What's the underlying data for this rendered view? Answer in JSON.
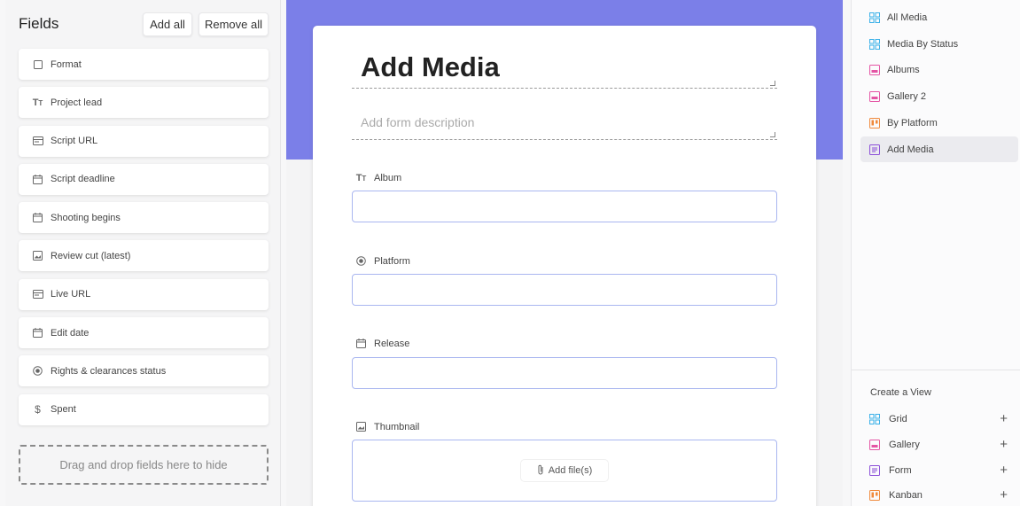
{
  "left_panel": {
    "title": "Fields",
    "add_all_label": "Add all",
    "remove_all_label": "Remove all",
    "fields": [
      {
        "label": "Format",
        "icon": "checkbox-icon"
      },
      {
        "label": "Project lead",
        "icon": "text-icon"
      },
      {
        "label": "Script URL",
        "icon": "url-icon"
      },
      {
        "label": "Script deadline",
        "icon": "calendar-icon"
      },
      {
        "label": "Shooting begins",
        "icon": "calendar-icon"
      },
      {
        "label": "Review cut (latest)",
        "icon": "attachment-image-icon"
      },
      {
        "label": "Live URL",
        "icon": "url-icon"
      },
      {
        "label": "Edit date",
        "icon": "calendar-icon"
      },
      {
        "label": "Rights & clearances status",
        "icon": "radio-icon"
      },
      {
        "label": "Spent",
        "icon": "currency-icon"
      }
    ],
    "dropzone_text": "Drag and drop fields here to hide"
  },
  "form": {
    "title": "Add Media",
    "description_placeholder": "Add form description",
    "questions": [
      {
        "label": "Album",
        "icon": "text-icon"
      },
      {
        "label": "Platform",
        "icon": "radio-icon"
      },
      {
        "label": "Release",
        "icon": "calendar-icon"
      },
      {
        "label": "Thumbnail",
        "icon": "attachment-image-icon"
      }
    ],
    "add_file_label": "Add file(s)"
  },
  "views": {
    "items": [
      {
        "label": "All Media",
        "icon": "grid-icon",
        "color": "#3ab0e8"
      },
      {
        "label": "Media By Status",
        "icon": "grid-icon",
        "color": "#3ab0e8"
      },
      {
        "label": "Albums",
        "icon": "gallery-icon",
        "color": "#e454a4"
      },
      {
        "label": "Gallery 2",
        "icon": "gallery-icon",
        "color": "#e454a4"
      },
      {
        "label": "By Platform",
        "icon": "kanban-icon",
        "color": "#f08a3c"
      },
      {
        "label": "Add Media",
        "icon": "form-icon",
        "color": "#8b4fd8"
      }
    ],
    "active": "Add Media",
    "create_title": "Create a View",
    "create_items": [
      {
        "label": "Grid",
        "icon": "grid-icon",
        "color": "#3ab0e8"
      },
      {
        "label": "Gallery",
        "icon": "gallery-icon",
        "color": "#e454a4"
      },
      {
        "label": "Form",
        "icon": "form-icon",
        "color": "#8b4fd8"
      },
      {
        "label": "Kanban",
        "icon": "kanban-icon",
        "color": "#f08a3c"
      }
    ]
  },
  "colors": {
    "banner": "#7b7fe8",
    "input_border": "#a9b6f0"
  }
}
